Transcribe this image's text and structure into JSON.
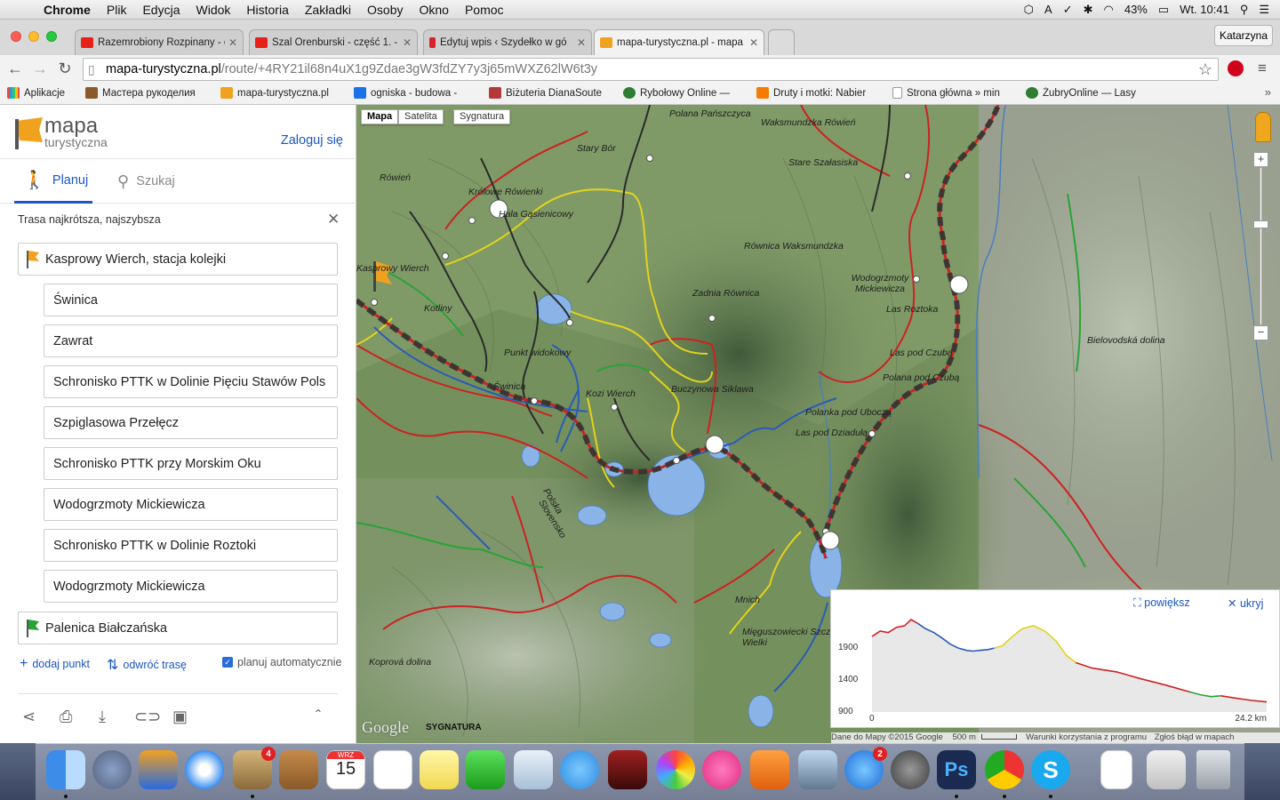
{
  "menubar": {
    "items": [
      "Chrome",
      "Plik",
      "Edycja",
      "Widok",
      "Historia",
      "Zakładki",
      "Osoby",
      "Okno",
      "Pomoc"
    ],
    "battery": "43%",
    "clock": "Wt. 10:41"
  },
  "browser": {
    "tabs": [
      {
        "label": "Razemrobiony Rozpinany - c",
        "fav_color": "#e62117"
      },
      {
        "label": "Szal Orenburski - część 1. -",
        "fav_color": "#e62117"
      },
      {
        "label": "Edytuj wpis ‹ Szydełko w gó",
        "fav_color": "#d8232a"
      },
      {
        "label": "mapa-turystyczna.pl - mapa",
        "fav_color": "#f0a21e"
      }
    ],
    "profile": "Katarzyna",
    "url_host": "mapa-turystyczna.pl",
    "url_path": "/route/+4RY21il68n4uX1g9Zdae3gW3fdZY7y3j65mWXZ62lW6t3y",
    "bookmarks": [
      {
        "label": "Aplikacje",
        "color": "#e74c3c"
      },
      {
        "label": "Мастера рукоделия",
        "color": "#8a5a2b"
      },
      {
        "label": "mapa-turystyczna.pl",
        "color": "#f0a21e"
      },
      {
        "label": "ogniska - budowa -",
        "color": "#1a73e8"
      },
      {
        "label": "Biżuteria DianaSoute",
        "color": "#b43a3a"
      },
      {
        "label": "Rybołowy Online —",
        "color": "#2e7d32"
      },
      {
        "label": "Druty i motki: Nabier",
        "color": "#f57c00"
      },
      {
        "label": "Strona główna » min",
        "color": "#9e9e9e"
      },
      {
        "label": "ŻubryOnline — Lasy",
        "color": "#2e7d32"
      }
    ]
  },
  "sidebar": {
    "logo_line1": "mapa",
    "logo_line2": "turystyczna",
    "login": "Zaloguj się",
    "tab_plan": "Planuj",
    "tab_search": "Szukaj",
    "route_type": "Trasa najkrótsza, najszybsza",
    "start": "Kasprowy Wierch, stacja kolejki",
    "waypoints": [
      "Świnica",
      "Zawrat",
      "Schronisko PTTK w Dolinie Pięciu Stawów Pols",
      "Szpiglasowa Przełęcz",
      "Schronisko PTTK przy Morskim Oku",
      "Wodogrzmoty Mickiewicza",
      "Schronisko PTTK w Dolinie Roztoki",
      "Wodogrzmoty Mickiewicza"
    ],
    "end": "Palenica Białczańska",
    "add_point": "dodaj punkt",
    "reverse": "odwróć trasę",
    "auto_plan": "planuj automatycznie",
    "auto_plan_checked": true
  },
  "map": {
    "type_buttons": [
      "Mapa",
      "Satelita",
      "Sygnatura"
    ],
    "selected_type": "Mapa",
    "labels": [
      "Polana Pańszczyca",
      "Waksmundzka Rówień",
      "Stary Bór",
      "Stare Szałasiska",
      "Rówień",
      "Królowe Rówienki",
      "Hala Gąsienicowy",
      "Równica Waksmundzka",
      "Wodogrzmoty Mickiewicza",
      "Zadnia Równica",
      "Kotliny",
      "Punkt widokowy",
      "Las Roztoka",
      "Bielovodská dolina",
      "Las pod Czubą",
      "Polana pod Czubą",
      "Świnica",
      "Kozi Wierch",
      "Buczynowa Siklawa",
      "Polanka pod Uboczą",
      "Las pod Dziadułą",
      "Polska",
      "Slovensko",
      "Mnich",
      "Mięguszowiecki Szczyt Wielki",
      "Koprová dolina",
      "Kasprowy Wierch"
    ],
    "google": "Google",
    "sygnatura": "SYGNATURA",
    "attribution": "Dane do Mapy ©2015 Google",
    "scale": "500 m",
    "terms": "Warunki korzystania z programu",
    "report": "Zgłoś błąd w mapach"
  },
  "elevation": {
    "enlarge": "powiększ",
    "hide": "ukryj",
    "y_ticks": [
      "1900",
      "1400",
      "900"
    ],
    "x_start": "0",
    "x_end": "24.2 km"
  },
  "chart_data": {
    "type": "line",
    "title": "",
    "xlabel": "",
    "ylabel": "",
    "xlim": [
      0,
      24.2
    ],
    "ylim": [
      900,
      2250
    ],
    "series": [
      {
        "color": "#cc2222",
        "x": [
          0,
          0.5,
          1,
          1.5,
          2,
          2.4,
          2.8
        ],
        "y": [
          1880,
          1950,
          1930,
          2000,
          2020,
          2100,
          2050
        ]
      },
      {
        "color": "#2a5cb8",
        "x": [
          2.8,
          3.3,
          3.8,
          4.3,
          4.8,
          5.3,
          5.8,
          6.2,
          6.6,
          7.1,
          7.5
        ],
        "y": [
          2050,
          1980,
          1930,
          1860,
          1780,
          1730,
          1700,
          1690,
          1700,
          1710,
          1730
        ]
      },
      {
        "color": "#e4d21a",
        "x": [
          7.5,
          8.0,
          8.6,
          9.2,
          9.9,
          10.6,
          11.3,
          11.9,
          12.5
        ],
        "y": [
          1730,
          1760,
          1880,
          1980,
          2020,
          1950,
          1820,
          1640,
          1540
        ]
      },
      {
        "color": "#cc2222",
        "x": [
          12.5,
          13.5,
          15,
          16.5,
          18,
          19.5
        ],
        "y": [
          1540,
          1470,
          1420,
          1330,
          1250,
          1160
        ]
      },
      {
        "color": "#2aa336",
        "x": [
          19.5,
          20.2,
          20.8,
          21.4
        ],
        "y": [
          1160,
          1120,
          1100,
          1110
        ]
      },
      {
        "color": "#cc2222",
        "x": [
          21.4,
          22.3,
          23.3,
          24.2
        ],
        "y": [
          1110,
          1080,
          1050,
          1030
        ]
      }
    ]
  },
  "dock": {
    "calendar_month": "WRZ",
    "calendar_day": "15",
    "mail_badge": "4",
    "appstore_badge": "2",
    "ps_label": "Ps",
    "skype_label": "S"
  }
}
